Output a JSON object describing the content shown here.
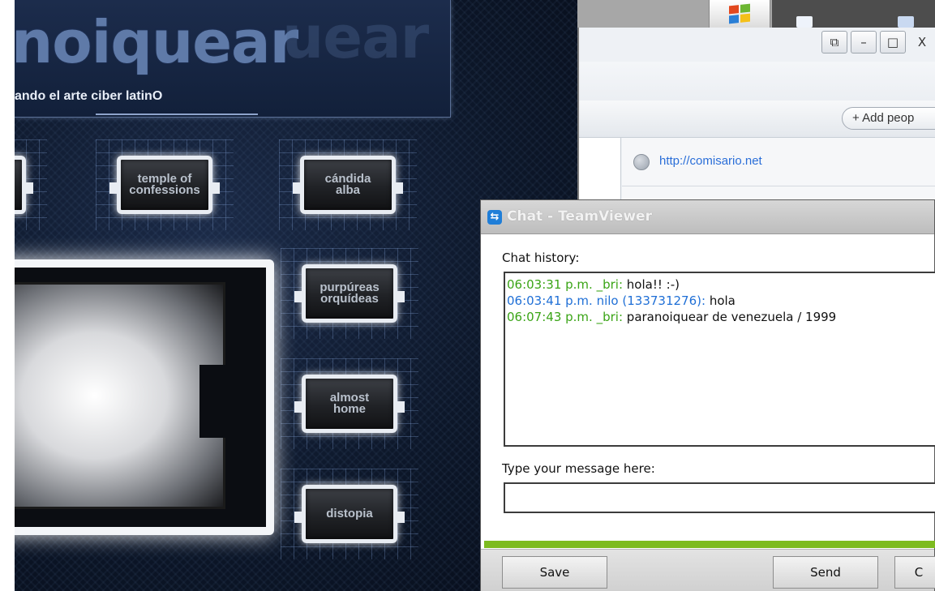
{
  "website": {
    "logo_text": "noiquear",
    "logo_ghost_text": "uear",
    "tagline": "ando el arte ciber latinO",
    "tiles": [
      {
        "label": ""
      },
      {
        "label": "temple of\nconfessions"
      },
      {
        "label": "cándida\nalba"
      },
      {
        "label": "purpúreas\norquídeas"
      },
      {
        "label": "almost\nhome"
      },
      {
        "label": "distopia"
      }
    ]
  },
  "browser": {
    "window_controls": {
      "restore": "⧉",
      "minimize": "–",
      "maximize": "□",
      "close": "X"
    },
    "add_people_label": "+ Add peop",
    "link_text": "http://comisario.net"
  },
  "chat": {
    "window_title": "Chat - TeamViewer",
    "app_icon": "teamviewer-icon",
    "history_label": "Chat history:",
    "messages": [
      {
        "time": "06:03:31 p.m.",
        "nick": "_bri:",
        "text": "hola!! :-)",
        "color": "#3aa416"
      },
      {
        "time": "06:03:41 p.m.",
        "nick": "nilo (133731276):",
        "text": "hola",
        "color": "#1f6fd6"
      },
      {
        "time": "06:07:43 p.m.",
        "nick": "_bri:",
        "text": "paranoiquear de venezuela / 1999",
        "color": "#3aa416"
      }
    ],
    "input_label": "Type your message here:",
    "input_value": "",
    "progress": 1.0,
    "buttons": {
      "save": "Save",
      "send": "Send",
      "close_partial": "C"
    }
  }
}
